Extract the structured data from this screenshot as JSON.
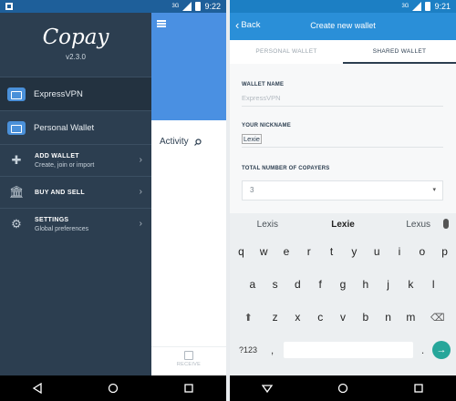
{
  "left_screen": {
    "status": {
      "time": "9:22",
      "network": "3G"
    },
    "drawer": {
      "brand": "Copay",
      "version": "v2.3.0",
      "wallets": [
        {
          "label": "ExpressVPN"
        },
        {
          "label": "Personal Wallet"
        }
      ],
      "menu": [
        {
          "title": "ADD WALLET",
          "subtitle": "Create, join or import",
          "icon": "plus-icon"
        },
        {
          "title": "BUY AND SELL",
          "subtitle": "",
          "icon": "bank-icon"
        },
        {
          "title": "SETTINGS",
          "subtitle": "Global preferences",
          "icon": "gear-icon"
        }
      ]
    },
    "main": {
      "activity_label": "Activity",
      "receive_label": "RECEIVE"
    }
  },
  "right_screen": {
    "status": {
      "time": "9:21",
      "network": "3G"
    },
    "header": {
      "back_label": "Back",
      "title": "Create new wallet"
    },
    "tabs": [
      {
        "label": "PERSONAL WALLET",
        "active": false
      },
      {
        "label": "SHARED WALLET",
        "active": true
      }
    ],
    "form": {
      "wallet_name_label": "WALLET NAME",
      "wallet_name_placeholder": "ExpressVPN",
      "nickname_label": "YOUR NICKNAME",
      "nickname_value": "Lexie",
      "copayers_label": "TOTAL NUMBER OF COPAYERS",
      "copayers_value": "3"
    },
    "keyboard": {
      "suggestions": [
        "Lexis",
        "Lexie",
        "Lexus"
      ],
      "row1": [
        "q",
        "w",
        "e",
        "r",
        "t",
        "y",
        "u",
        "i",
        "o",
        "p"
      ],
      "row2": [
        "a",
        "s",
        "d",
        "f",
        "g",
        "h",
        "j",
        "k",
        "l"
      ],
      "row3": [
        "z",
        "x",
        "c",
        "v",
        "b",
        "n",
        "m"
      ],
      "symbols_label": "?123",
      "comma": ",",
      "period": "."
    }
  },
  "colors": {
    "drawer_bg": "#2c3e50",
    "accent_blue": "#4a90e2",
    "header_blue": "#2a8fd8",
    "enter_green": "#26a69a"
  }
}
